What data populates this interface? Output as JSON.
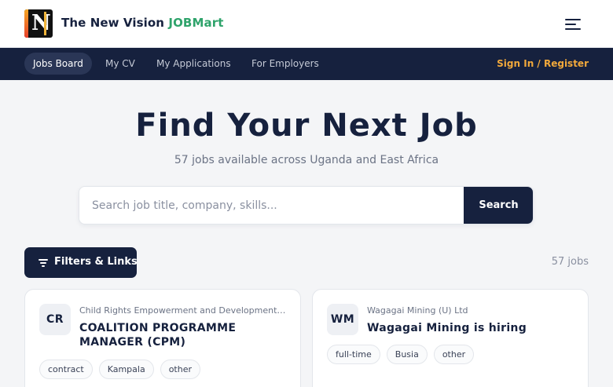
{
  "brand": {
    "logo_letter": "N",
    "name_main": "The New Vision ",
    "name_accent": "JOBMart",
    "icon": "hamburger-menu-icon"
  },
  "nav": {
    "items": [
      {
        "label": "Jobs Board",
        "active": true
      },
      {
        "label": "My CV",
        "active": false
      },
      {
        "label": "My Applications",
        "active": false
      },
      {
        "label": "For Employers",
        "active": false
      }
    ],
    "signin_label": "Sign In / Register"
  },
  "hero": {
    "title": "Find Your Next Job",
    "subtitle": "57 jobs available across Uganda and East Africa"
  },
  "search": {
    "placeholder": "Search job title, company, skills...",
    "value": "",
    "button_label": "Search"
  },
  "filters": {
    "button_label": "Filters & Links",
    "icon": "filter-lines-icon",
    "count_label": "57 jobs"
  },
  "jobs": [
    {
      "initials": "CR",
      "company": "Child Rights Empowerment and Development ...",
      "title": "COALITION PROGRAMME MANAGER (CPM)",
      "tags": [
        "contract",
        "Kampala",
        "other"
      ]
    },
    {
      "initials": "WM",
      "company": "Wagagai Mining (U) Ltd",
      "title": "Wagagai Mining is hiring",
      "tags": [
        "full-time",
        "Busia",
        "other"
      ]
    }
  ],
  "colors": {
    "navy": "#16213e",
    "accent_green": "#2fa36b",
    "signin_orange": "#f2a93b",
    "page_bg": "#f4f5f7"
  }
}
